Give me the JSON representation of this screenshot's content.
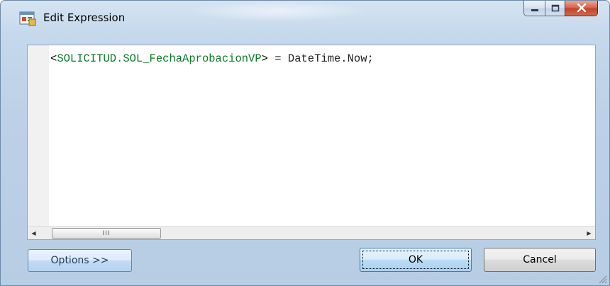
{
  "window": {
    "title": "Edit Expression"
  },
  "caption": {
    "minimize_icon": "minimize-icon",
    "maximize_icon": "maximize-icon",
    "close_icon": "close-icon"
  },
  "editor": {
    "code": {
      "open": "<",
      "field": "SOLICITUD.SOL_FechaAprobacionVP",
      "close": ">",
      "rest": " = DateTime.Now;"
    }
  },
  "scrollbar": {
    "thumb_grip": "III",
    "left_arrow": "◀",
    "right_arrow": "▶"
  },
  "buttons": {
    "options": "Options >>",
    "ok": "OK",
    "cancel": "Cancel"
  },
  "colors": {
    "field_token": "#0a7a25",
    "close_button": "#c2432a"
  }
}
